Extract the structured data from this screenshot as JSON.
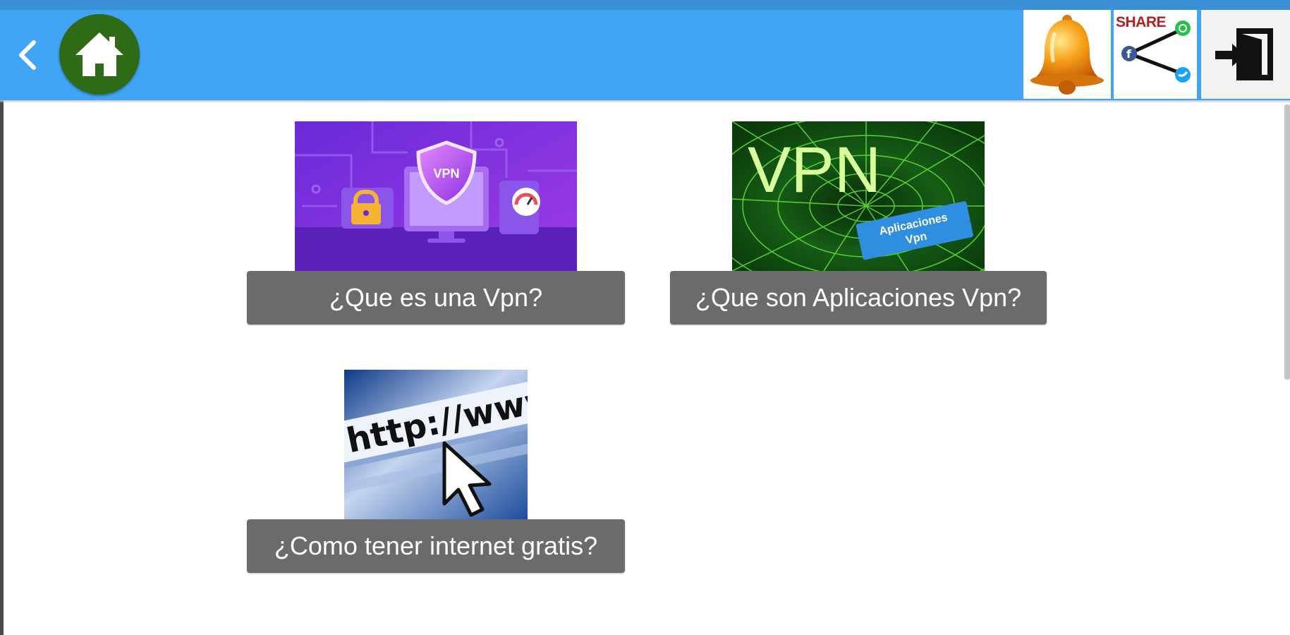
{
  "toolbar": {
    "back_icon": "chevron-left-icon",
    "home_icon": "home-icon",
    "notification_icon": "bell-icon",
    "share": {
      "label": "SHARE",
      "icon": "share-network-icon"
    },
    "exit_icon": "exit-door-icon"
  },
  "colors": {
    "app_bar": "#42a4f5",
    "home_button": "#2f6a16",
    "caption_bg": "#6b6b6b",
    "caption_text": "#ffffff"
  },
  "cards": [
    {
      "caption": "¿Que es una Vpn?",
      "image": {
        "badge": "VPN",
        "description_icon": "vpn-shield-illustration"
      }
    },
    {
      "caption": "¿Que son Aplicaciones Vpn?",
      "image": {
        "title": "VPN",
        "tag_line1": "Aplicaciones",
        "tag_line2": "Vpn"
      }
    },
    {
      "caption": "¿Como tener internet gratis?",
      "image": {
        "text": "http://www"
      }
    }
  ]
}
